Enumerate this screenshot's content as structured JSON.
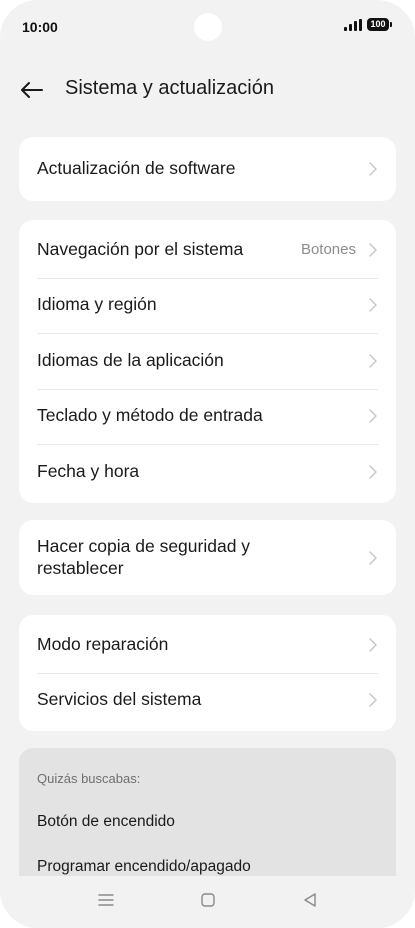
{
  "status_bar": {
    "time": "10:00",
    "battery": "100",
    "signal_icon": "signal-icon",
    "battery_icon": "battery-icon"
  },
  "header": {
    "back_icon": "back-arrow-icon",
    "title": "Sistema y actualización"
  },
  "cards": {
    "software": {
      "label": "Actualización de software"
    },
    "system": {
      "items": [
        {
          "label": "Navegación por el sistema",
          "value": "Botones"
        },
        {
          "label": "Idioma y región"
        },
        {
          "label": "Idiomas de la aplicación"
        },
        {
          "label": "Teclado y método de entrada"
        },
        {
          "label": "Fecha y hora"
        }
      ]
    },
    "backup": {
      "label": "Hacer copia de seguridad y restablecer"
    },
    "repair": {
      "items": [
        {
          "label": "Modo reparación"
        },
        {
          "label": "Servicios del sistema"
        }
      ]
    }
  },
  "suggestions": {
    "title": "Quizás buscabas:",
    "items": [
      "Botón de encendido",
      "Programar encendido/apagado"
    ]
  },
  "nav_bar": {
    "menu_icon": "menu-icon",
    "home_icon": "home-icon",
    "back_icon": "back-triangle-icon"
  },
  "colors": {
    "background": "#f2f2f2",
    "card": "#ffffff",
    "suggest_bg": "#e3e3e3",
    "secondary_text": "#8c8c8c"
  }
}
